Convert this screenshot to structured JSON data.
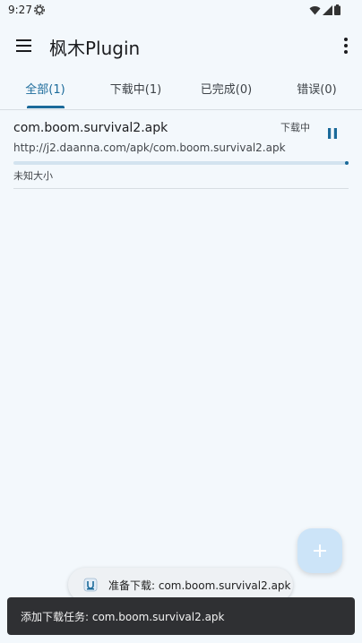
{
  "status_bar": {
    "time": "9:27"
  },
  "app_bar": {
    "title": "枫木Plugin"
  },
  "tabs": [
    {
      "label": "全部(1)",
      "active": true
    },
    {
      "label": "下载中(1)",
      "active": false
    },
    {
      "label": "已完成(0)",
      "active": false
    },
    {
      "label": "错误(0)",
      "active": false
    }
  ],
  "download": {
    "file_name": "com.boom.survival2.apk",
    "status": "下载中",
    "url": "http://j2.daanna.com/apk/com.boom.survival2.apk",
    "size": "未知大小",
    "progress_percent": 0
  },
  "toast": {
    "text": "准备下载: com.boom.survival2.apk"
  },
  "snackbar": {
    "text": "添加下载任务: com.boom.survival2.apk"
  },
  "colors": {
    "accent": "#1b6a9a",
    "background": "#f3f8fc",
    "fab": "#cce4f8",
    "snackbar": "#2f3033"
  }
}
